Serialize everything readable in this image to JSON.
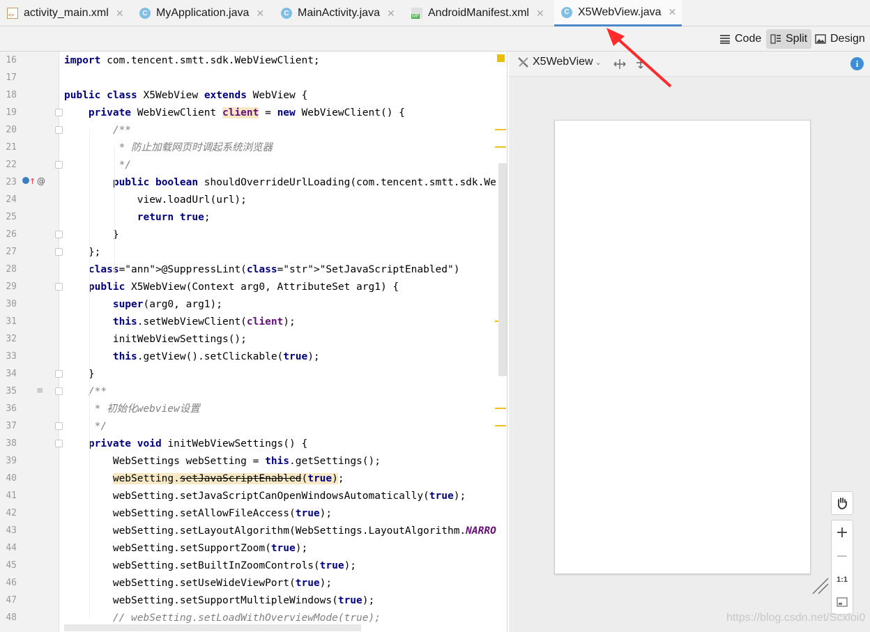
{
  "tabs": [
    {
      "label": "activity_main.xml",
      "icon": "xml-file-icon"
    },
    {
      "label": "MyApplication.java",
      "icon": "class-icon"
    },
    {
      "label": "MainActivity.java",
      "icon": "class-icon"
    },
    {
      "label": "AndroidManifest.xml",
      "icon": "manifest-file-icon"
    },
    {
      "label": "X5WebView.java",
      "icon": "class-icon",
      "active": true
    }
  ],
  "view_modes": {
    "code": "Code",
    "split": "Split",
    "design": "Design",
    "selected": "Split"
  },
  "editor": {
    "line_numbers": [
      "16",
      "17",
      "18",
      "19",
      "20",
      "21",
      "22",
      "23",
      "24",
      "25",
      "26",
      "27",
      "28",
      "29",
      "30",
      "31",
      "32",
      "33",
      "34",
      "35",
      "36",
      "37",
      "38",
      "39",
      "40",
      "41",
      "42",
      "43",
      "44",
      "45",
      "46",
      "47",
      "48"
    ],
    "lines": [
      "import com.tencent.smtt.sdk.WebViewClient;",
      "",
      "public class X5WebView extends WebView {",
      "    private WebViewClient client = new WebViewClient() {",
      "        /**",
      "         * 防止加载网页时调起系统浏览器",
      "         */",
      "        public boolean shouldOverrideUrlLoading(com.tencent.smtt.sdk.We",
      "            view.loadUrl(url);",
      "            return true;",
      "        }",
      "    };",
      "    @SuppressLint(\"SetJavaScriptEnabled\")",
      "    public X5WebView(Context arg0, AttributeSet arg1) {",
      "        super(arg0, arg1);",
      "        this.setWebViewClient(client);",
      "        initWebViewSettings();",
      "        this.getView().setClickable(true);",
      "    }",
      "    /**",
      "     * 初始化webview设置",
      "     */",
      "    private void initWebViewSettings() {",
      "        WebSettings webSetting = this.getSettings();",
      "        webSetting.setJavaScriptEnabled(true);",
      "        webSetting.setJavaScriptCanOpenWindowsAutomatically(true);",
      "        webSetting.setAllowFileAccess(true);",
      "        webSetting.setLayoutAlgorithm(WebSettings.LayoutAlgorithm.NARRO",
      "        webSetting.setSupportZoom(true);",
      "        webSetting.setBuiltInZoomControls(true);",
      "        webSetting.setUseWideViewPort(true);",
      "        webSetting.setSupportMultipleWindows(true);",
      "        // webSetting.setLoadWithOverviewMode(true);"
    ],
    "gutter_icon_line23": "@"
  },
  "design": {
    "component": "X5WebView",
    "zoom_actual": "1:1",
    "icons": [
      "pan-hand-icon",
      "zoom-in-icon",
      "zoom-out-icon",
      "zoom-fit-icon",
      "info-icon"
    ]
  },
  "watermark": "https://blog.csdn.net/Scxioi0",
  "colors": {
    "keyword": "#000080",
    "string": "#008000",
    "comment": "#808080",
    "annotation": "#808000",
    "field": "#660e7a",
    "arrow": "#ff2a2a",
    "active_tab_underline": "#4a88c7"
  }
}
